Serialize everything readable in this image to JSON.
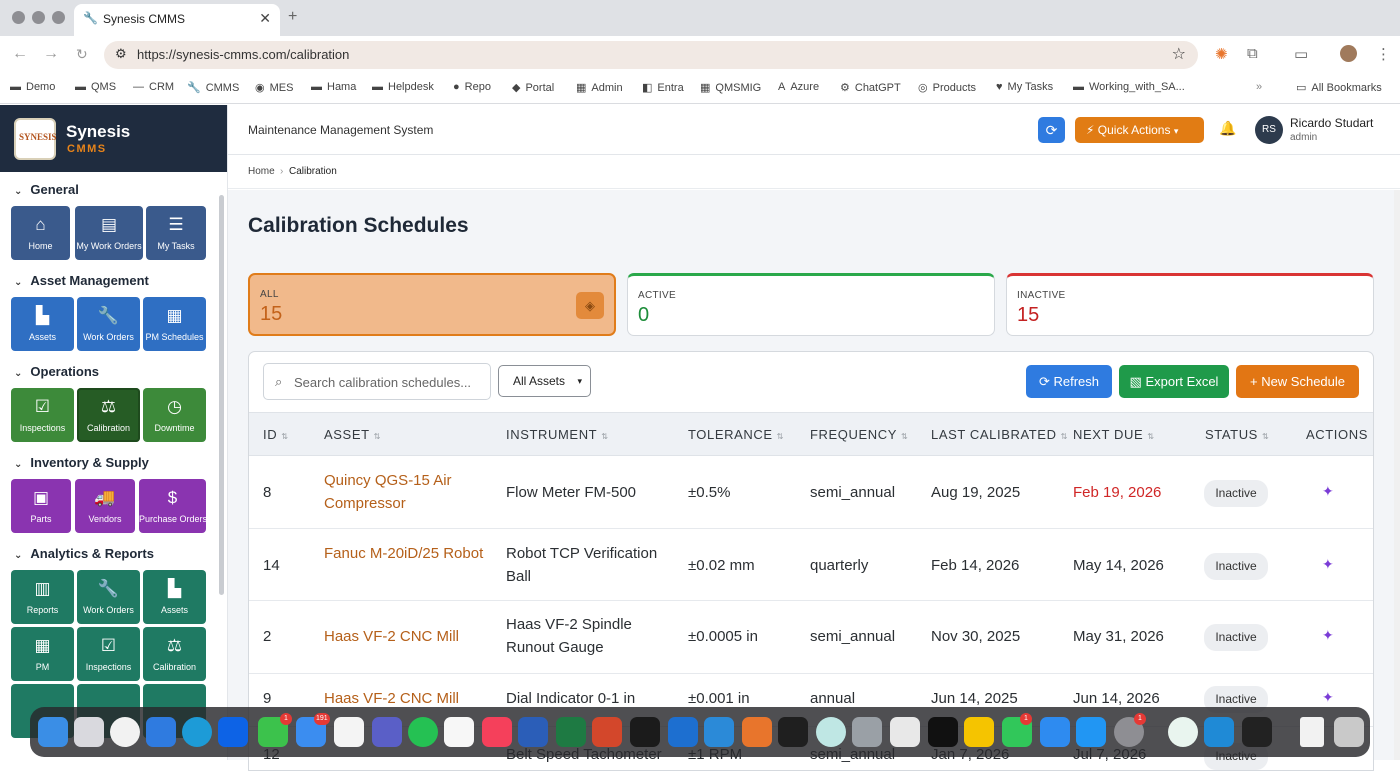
{
  "browser": {
    "tab_title": "Synesis CMMS",
    "url": "https://synesis-cmms.com/calibration",
    "bookmarks": [
      "Demo",
      "QMS",
      "CRM",
      "CMMS",
      "MES",
      "Hama",
      "Helpdesk",
      "Repo",
      "Portal",
      "Admin",
      "Entra",
      "QMSMIG",
      "Azure",
      "ChatGPT",
      "Products",
      "My Tasks",
      "Working_with_SA...",
      "All Bookmarks"
    ]
  },
  "brand": {
    "name": "Synesis",
    "sub": "CMMS",
    "logo_text": "SYNESIS"
  },
  "sidebar": {
    "sections": [
      {
        "title": "General",
        "items": [
          {
            "label": "Home",
            "icon": "home-icon"
          },
          {
            "label": "My Work Orders",
            "icon": "clipboard-icon"
          },
          {
            "label": "My Tasks",
            "icon": "checklist-icon"
          }
        ]
      },
      {
        "title": "Asset Management",
        "items": [
          {
            "label": "Assets",
            "icon": "factory-icon"
          },
          {
            "label": "Work Orders",
            "icon": "wrench-icon"
          },
          {
            "label": "PM Schedules",
            "icon": "calendar-icon"
          }
        ]
      },
      {
        "title": "Operations",
        "items": [
          {
            "label": "Inspections",
            "icon": "clipboard-check-icon"
          },
          {
            "label": "Calibration",
            "icon": "scale-icon"
          },
          {
            "label": "Downtime",
            "icon": "clock-icon"
          }
        ]
      },
      {
        "title": "Inventory & Supply",
        "items": [
          {
            "label": "Parts",
            "icon": "boxes-icon"
          },
          {
            "label": "Vendors",
            "icon": "truck-icon"
          },
          {
            "label": "Purchase Orders",
            "icon": "invoice-icon"
          }
        ]
      },
      {
        "title": "Analytics & Reports",
        "items": [
          {
            "label": "Reports",
            "icon": "chart-icon"
          },
          {
            "label": "Work Orders",
            "icon": "wrench-icon"
          },
          {
            "label": "Assets",
            "icon": "factory-icon"
          },
          {
            "label": "PM",
            "icon": "calendar-icon"
          },
          {
            "label": "Inspections",
            "icon": "clipboard-check-icon"
          },
          {
            "label": "Calibration",
            "icon": "scale-icon"
          }
        ]
      }
    ]
  },
  "header": {
    "title": "Maintenance Management System",
    "quick_actions": "Quick Actions",
    "user_initials": "RS",
    "user_name": "Ricardo Studart",
    "user_role": "admin"
  },
  "breadcrumb": {
    "home": "Home",
    "current": "Calibration"
  },
  "page": {
    "title": "Calibration Schedules"
  },
  "stats": {
    "all": {
      "label": "ALL",
      "value": "15"
    },
    "active": {
      "label": "ACTIVE",
      "value": "0"
    },
    "inactive": {
      "label": "INACTIVE",
      "value": "15"
    }
  },
  "toolbar": {
    "search_placeholder": "Search calibration schedules...",
    "asset_filter": "All Assets",
    "refresh": "Refresh",
    "export": "Export Excel",
    "new": "New Schedule"
  },
  "table": {
    "columns": [
      "ID",
      "ASSET",
      "INSTRUMENT",
      "TOLERANCE",
      "FREQUENCY",
      "LAST CALIBRATED",
      "NEXT DUE",
      "STATUS",
      "ACTIONS"
    ],
    "rows": [
      {
        "id": "8",
        "asset": "Quincy QGS-15 Air Compressor",
        "instrument": "Flow Meter FM-500",
        "tolerance": "±0.5%",
        "frequency": "semi_annual",
        "last": "Aug 19, 2025",
        "next": "Feb 19, 2026",
        "status": "Inactive",
        "overdue": true
      },
      {
        "id": "14",
        "asset": "Fanuc M-20iD/25 Robot",
        "instrument": "Robot TCP Verification Ball",
        "tolerance": "±0.02 mm",
        "frequency": "quarterly",
        "last": "Feb 14, 2026",
        "next": "May 14, 2026",
        "status": "Inactive",
        "overdue": false
      },
      {
        "id": "2",
        "asset": "Haas VF-2 CNC Mill",
        "instrument": "Haas VF-2 Spindle Runout Gauge",
        "tolerance": "±0.0005 in",
        "frequency": "semi_annual",
        "last": "Nov 30, 2025",
        "next": "May 31, 2026",
        "status": "Inactive",
        "overdue": false
      },
      {
        "id": "9",
        "asset": "Haas VF-2 CNC Mill",
        "instrument": "Dial Indicator 0-1 in",
        "tolerance": "±0.001 in",
        "frequency": "annual",
        "last": "Jun 14, 2025",
        "next": "Jun 14, 2026",
        "status": "Inactive",
        "overdue": false
      },
      {
        "id": "12",
        "asset": "",
        "instrument": "Belt Speed Tachometer",
        "tolerance": "±1 RPM",
        "frequency": "semi_annual",
        "last": "Jan 7, 2026",
        "next": "Jul 7, 2026",
        "status": "Inactive",
        "overdue": false
      }
    ]
  },
  "colors": {
    "accent_orange": "#e27614",
    "accent_blue": "#2f7be0",
    "success": "#1f9a4a",
    "danger": "#d02626",
    "sidebar_dark": "#1f2c3f"
  }
}
